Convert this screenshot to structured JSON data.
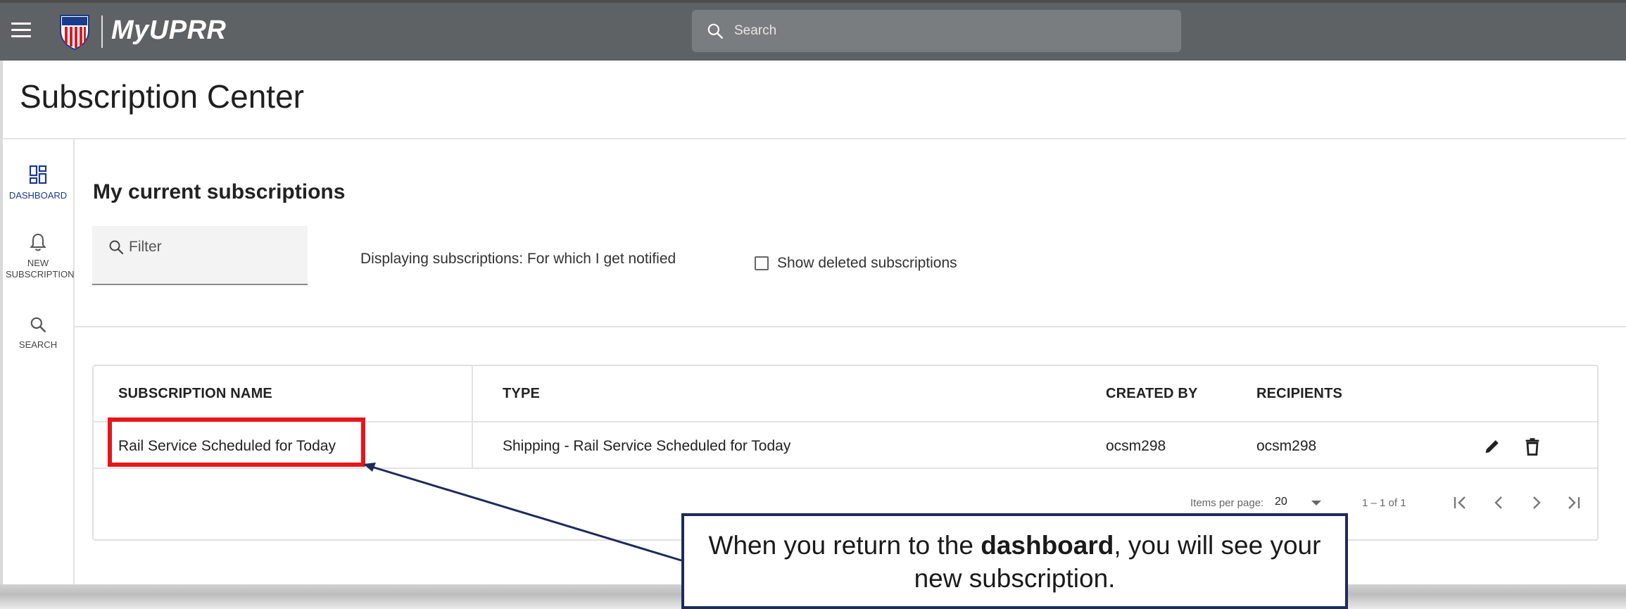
{
  "header": {
    "brand": "MyUPRR",
    "search_placeholder": "Search"
  },
  "page": {
    "title": "Subscription Center"
  },
  "rail": {
    "items": [
      {
        "label": "DASHBOARD",
        "icon": "dashboard-icon",
        "active": true
      },
      {
        "label": "NEW SUBSCRIPTION",
        "icon": "bell-icon",
        "active": false
      },
      {
        "label": "SEARCH",
        "icon": "search-icon",
        "active": false
      }
    ]
  },
  "main": {
    "section_title": "My current subscriptions",
    "filter_placeholder": "Filter",
    "displaying_text": "Displaying subscriptions: For which I get notified",
    "show_deleted_label": "Show deleted subscriptions",
    "show_deleted_checked": false
  },
  "table": {
    "columns": [
      "SUBSCRIPTION NAME",
      "TYPE",
      "CREATED BY",
      "RECIPIENTS"
    ],
    "rows": [
      {
        "name": "Rail Service Scheduled for Today",
        "type": "Shipping - Rail Service Scheduled for Today",
        "created_by": "ocsm298",
        "recipients": "ocsm298"
      }
    ],
    "paginator": {
      "items_per_page_label": "Items per page:",
      "items_per_page_value": "20",
      "range": "1 – 1 of 1"
    }
  },
  "callout": {
    "text_before": "When you return to the ",
    "text_bold": "dashboard",
    "text_after": ", you will see your new subscription."
  },
  "colors": {
    "topbar": "#5f6264",
    "highlight": "#e8141b",
    "callout_border": "#1c2b5a",
    "active_rail": "#1a3c8c"
  }
}
